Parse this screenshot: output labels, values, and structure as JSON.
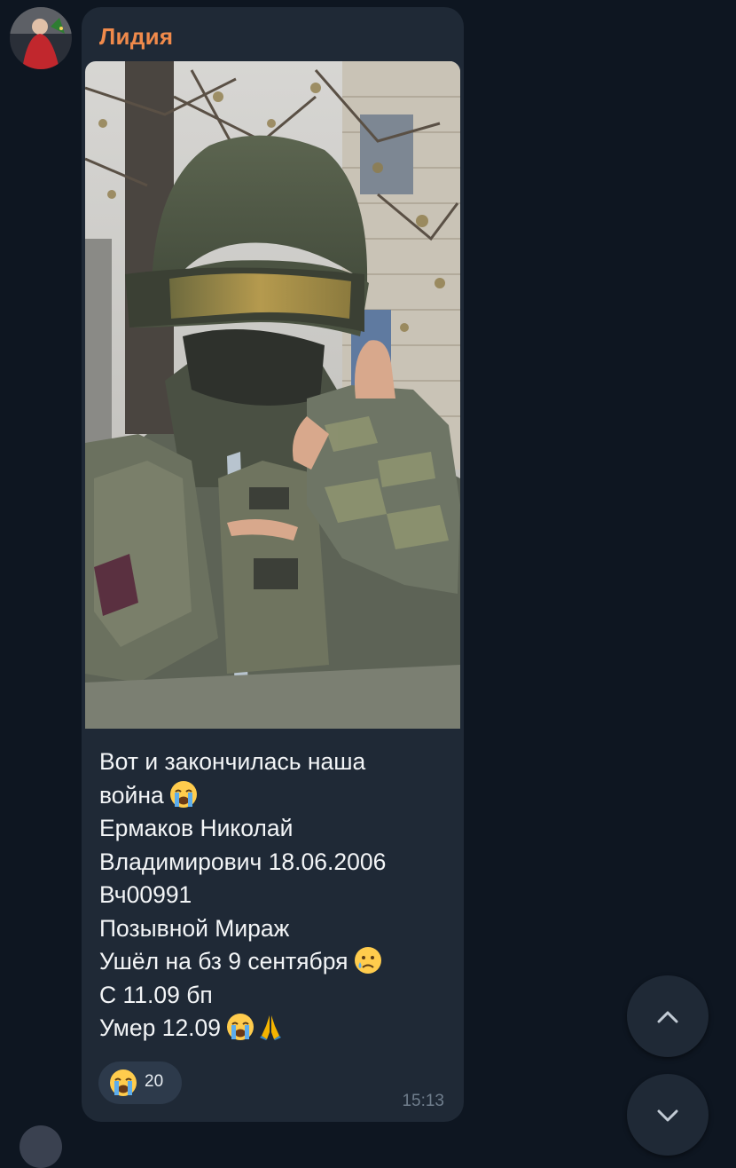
{
  "message": {
    "sender_name": "Лидия",
    "caption_lines": [
      {
        "text": "Вот и закончилась наша",
        "emoji": ""
      },
      {
        "text": "война",
        "emoji": "loudly-crying-face"
      },
      {
        "text": "Ермаков Николай",
        "emoji": ""
      },
      {
        "text": "Владимирович 18.06.2006",
        "emoji": ""
      },
      {
        "text": "Вч00991",
        "emoji": ""
      },
      {
        "text": "Позывной Мираж",
        "emoji": ""
      },
      {
        "text": "Ушёл на бз 9 сентября",
        "emoji": "crying-face"
      },
      {
        "text": "С 11.09 бп",
        "emoji": ""
      },
      {
        "text": "Умер 12.09",
        "emoji": "loudly-crying-face folded-hands"
      }
    ],
    "reaction": {
      "emoji": "loudly-crying-face",
      "count": "20"
    },
    "time": "15:13"
  },
  "navigation": {
    "scroll_up_icon": "chevron-up-icon",
    "scroll_down_icon": "chevron-down-icon"
  },
  "colors": {
    "background": "#0e1621",
    "bubble": "#1f2936",
    "sender": "#f08a4b",
    "text": "#f3f5f7",
    "time": "#6f7d8c",
    "reaction_pill": "#2d3a4b"
  }
}
